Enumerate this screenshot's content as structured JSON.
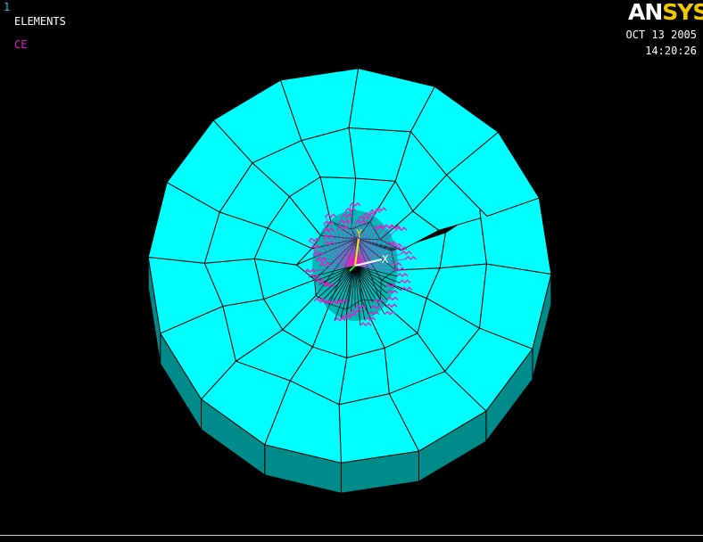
{
  "window_number": "1",
  "plot_title": "ELEMENTS",
  "legend": {
    "ce_label": "CE"
  },
  "logo": {
    "an": "AN",
    "sys": "SYS"
  },
  "timestamp": {
    "date": "OCT 13 2005",
    "time": "14:20:26"
  },
  "triad": {
    "y_label": "Y",
    "x_label": "X"
  },
  "colors": {
    "background": "#000000",
    "element_face": "#00ffff",
    "element_side": "#008b8b",
    "edges": "#000000",
    "constraint_equations": "#e020c0",
    "triad_y": "#f0f000",
    "triad_x": "#ffffff"
  },
  "mesh": {
    "rings": 4,
    "sectors": 16,
    "description_units": "elements"
  }
}
